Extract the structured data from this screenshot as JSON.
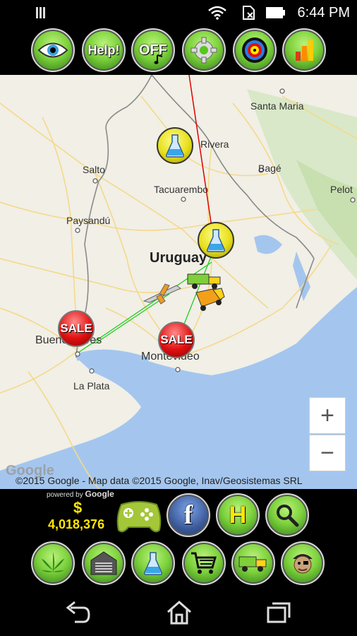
{
  "status_bar": {
    "time": "6:44 PM",
    "icons": [
      "notification-icon",
      "wifi-icon",
      "no-sim-icon",
      "battery-icon"
    ]
  },
  "top_buttons": [
    {
      "name": "view-eye-button",
      "icon": "eye-icon",
      "label": ""
    },
    {
      "name": "help-button",
      "icon": "",
      "label": "Help!"
    },
    {
      "name": "music-off-button",
      "icon": "music-note-icon",
      "label": "OFF"
    },
    {
      "name": "settings-button",
      "icon": "gear-icon",
      "label": ""
    },
    {
      "name": "target-button",
      "icon": "target-icon",
      "label": ""
    },
    {
      "name": "stats-button",
      "icon": "bar-chart-icon",
      "label": ""
    }
  ],
  "map": {
    "places": [
      "Santa Maria",
      "Rivera",
      "Salto",
      "Bagé",
      "Tacuarembo",
      "Pelot",
      "Paysandú",
      "Uruguay",
      "Buenos Aires",
      "Montevideo",
      "La Plata"
    ],
    "markers": [
      {
        "type": "lab",
        "icon": "flask-icon"
      },
      {
        "type": "lab",
        "icon": "flask-icon"
      },
      {
        "type": "sale",
        "label": "SALE"
      },
      {
        "type": "sale",
        "label": "SALE"
      }
    ],
    "vehicles": [
      "plane-icon",
      "truck-icon",
      "truck-icon"
    ],
    "zoom_in": "+",
    "zoom_out": "−",
    "google_watermark": "Google",
    "copyright": "©2015 Google - Map data ©2015 Google, Inav/Geosistemas SRL"
  },
  "bottom": {
    "powered_by": "powered by",
    "powered_brand": "Google",
    "currency_symbol": "$",
    "money": "4,018,376",
    "row1_buttons": [
      {
        "name": "gamepad-button",
        "icon": "gamepad-icon"
      },
      {
        "name": "facebook-button",
        "icon": "facebook-icon",
        "label": "f"
      },
      {
        "name": "hideout-button",
        "icon": "h-icon",
        "label": "H"
      },
      {
        "name": "search-button",
        "icon": "magnifier-icon"
      }
    ],
    "row2_buttons": [
      {
        "name": "weed-button",
        "icon": "leaf-icon"
      },
      {
        "name": "garage-button",
        "icon": "garage-icon"
      },
      {
        "name": "lab-button",
        "icon": "flask-icon"
      },
      {
        "name": "shop-button",
        "icon": "cart-icon"
      },
      {
        "name": "truck-button",
        "icon": "truck-icon"
      },
      {
        "name": "dealer-button",
        "icon": "pirate-icon"
      }
    ]
  },
  "nav": [
    "back-icon",
    "home-icon",
    "recents-icon"
  ]
}
